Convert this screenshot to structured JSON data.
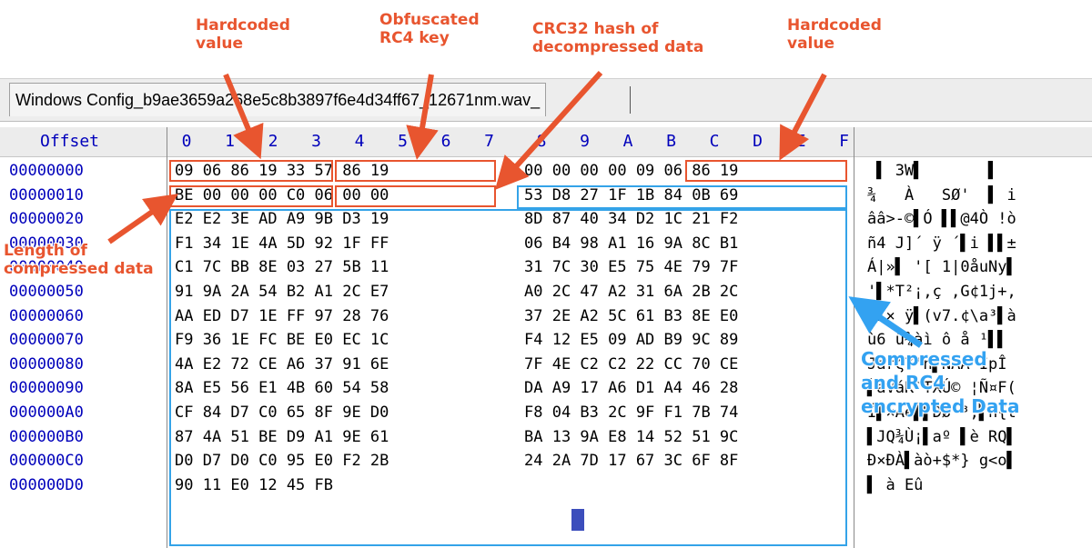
{
  "tab": {
    "title": "Windows Config_b9ae3659a268e5c8b3897f6e4d34ff67_12671nm.wav_"
  },
  "header": {
    "offset_label": "Offset",
    "columns": [
      "0",
      "1",
      "2",
      "3",
      "4",
      "5",
      "6",
      "7",
      "8",
      "9",
      "A",
      "B",
      "C",
      "D",
      "E",
      "F"
    ]
  },
  "rows": [
    {
      "offset": "00000000",
      "hex1": "09 06 86 19 33 57 86 19",
      "hex2": "00 00 00 00 09 06 86 19",
      "ascii": " ▌ 3W▌       ▌"
    },
    {
      "offset": "00000010",
      "hex1": "BE 00 00 00 C0 06 00 00",
      "hex2": "53 D8 27 1F 1B 84 0B 69",
      "ascii": "¾   À   SØ'  ▌ i"
    },
    {
      "offset": "00000020",
      "hex1": "E2 E2 3E AD A9 9B D3 19",
      "hex2": "8D 87 40 34 D2 1C 21 F2",
      "ascii": "ââ>-©▌Ó ▌▌@4Ò !ò"
    },
    {
      "offset": "00000030",
      "hex1": "F1 34 1E 4A 5D 92 1F FF",
      "hex2": "06 B4 98 A1 16 9A 8C B1",
      "ascii": "ñ4 J]´ ÿ ´▌i ▌▌±"
    },
    {
      "offset": "00000040",
      "hex1": "C1 7C BB 8E 03 27 5B 11",
      "hex2": "31 7C 30 E5 75 4E 79 7F",
      "ascii": "Á|»▌ '[ 1|0åuNy▌"
    },
    {
      "offset": "00000050",
      "hex1": "91 9A 2A 54 B2 A1 2C E7",
      "hex2": "A0 2C 47 A2 31 6A 2B 2C",
      "ascii": "'▌*T²¡,ç ,G¢1j+,"
    },
    {
      "offset": "00000060",
      "hex1": "AA ED D7 1E FF 97 28 76",
      "hex2": "37 2E A2 5C 61 B3 8E E0",
      "ascii": "ªí× ÿ▌(v7.¢\\a³▌à"
    },
    {
      "offset": "00000070",
      "hex1": "F9 36 1E FC BE E0 EC 1C",
      "hex2": "F4 12 E5 09 AD B9 9C 89",
      "ascii": "ù6 ü¾àì ô å ­¹▌▌"
    },
    {
      "offset": "00000080",
      "hex1": "4A E2 72 CE A6 37 91 6E",
      "hex2": "7F 4E C2 C2 22 CC 70 CE",
      "ascii": "Jârζ7'n▌NÂÂ\"ÌpÎ"
    },
    {
      "offset": "00000090",
      "hex1": "8A E5 56 E1 4B 60 54 58",
      "hex2": "DA A9 17 A6 D1 A4 46 28",
      "ascii": "▌åVáK`TXÚ© ¦Ñ¤F("
    },
    {
      "offset": "000000A0",
      "hex1": "CF 84 D7 C0 65 8F 9E D0",
      "hex2": "F8 04 B3 2C 9F F1 7B 74",
      "ascii": "Ï▌×Àe▌▌Ðø ³,▌ñ{t"
    },
    {
      "offset": "000000B0",
      "hex1": "87 4A 51 BE D9 A1 9E 61",
      "hex2": "BA 13 9A E8 14 52 51 9C",
      "ascii": "▌JQ¾Ù¡▌aº ▌è RQ▌"
    },
    {
      "offset": "000000C0",
      "hex1": "D0 D7 D0 C0 95 E0 F2 2B",
      "hex2": "24 2A 7D 17 67 3C 6F 8F",
      "ascii": "Ð×ÐÀ▌àò+$*} g<o▌"
    },
    {
      "offset": "000000D0",
      "hex1": "90 11 E0 12 45 FB",
      "hex2": "",
      "ascii": "▌ à Eû"
    }
  ],
  "annotations": {
    "hardcoded_left": "Hardcoded\nvalue",
    "obfuscated_key": "Obfuscated\nRC4 key",
    "crc32": "CRC32 hash of\ndecompressed data",
    "hardcoded_right": "Hardcoded\nvalue",
    "length": "Length of\ncompressed data",
    "compressed": "Compressed\nand RC4\nencrypted Data"
  },
  "colors": {
    "annotation_red": "#e8552f",
    "annotation_blue": "#33a2f1",
    "offset_blue": "#0000bb",
    "selection": "#1a2fb0"
  }
}
